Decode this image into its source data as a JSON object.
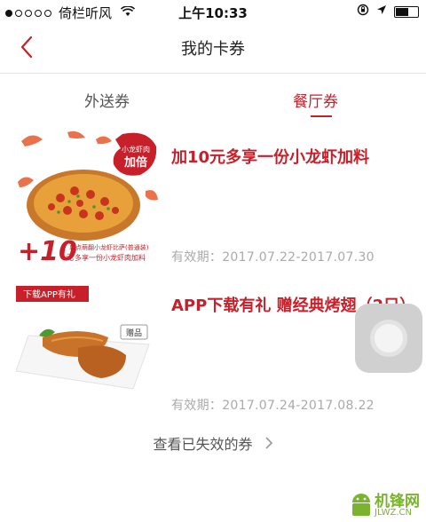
{
  "status_bar": {
    "carrier": "倚栏听风",
    "time": "上午10:33"
  },
  "nav": {
    "title": "我的卡券"
  },
  "tabs": [
    {
      "label": "外送券",
      "active": false
    },
    {
      "label": "餐厅券",
      "active": true
    }
  ],
  "coupons": [
    {
      "title": "加10元多享一份小龙虾加料",
      "validity": "有效期：2017.07.22-2017.07.30",
      "image": {
        "badge": "小龙虾肉 加倍",
        "price": "+10元",
        "caption_1": "单点萌翻小龙虾比萨(普通装)",
        "caption_2": "多享一份小龙虾肉加料"
      }
    },
    {
      "title": "APP下载有礼 赠经典烤翅（2只）",
      "validity": "有效期：2017.07.24-2017.08.22",
      "image": {
        "ribbon": "下载APP有礼",
        "tag": "赠品"
      }
    }
  ],
  "expired_link": "查看已失效的券",
  "watermark": {
    "text": "机锋网",
    "sub": "JLWZ.CN"
  },
  "colors": {
    "accent": "#c8202a",
    "muted": "#aaaaaa"
  }
}
